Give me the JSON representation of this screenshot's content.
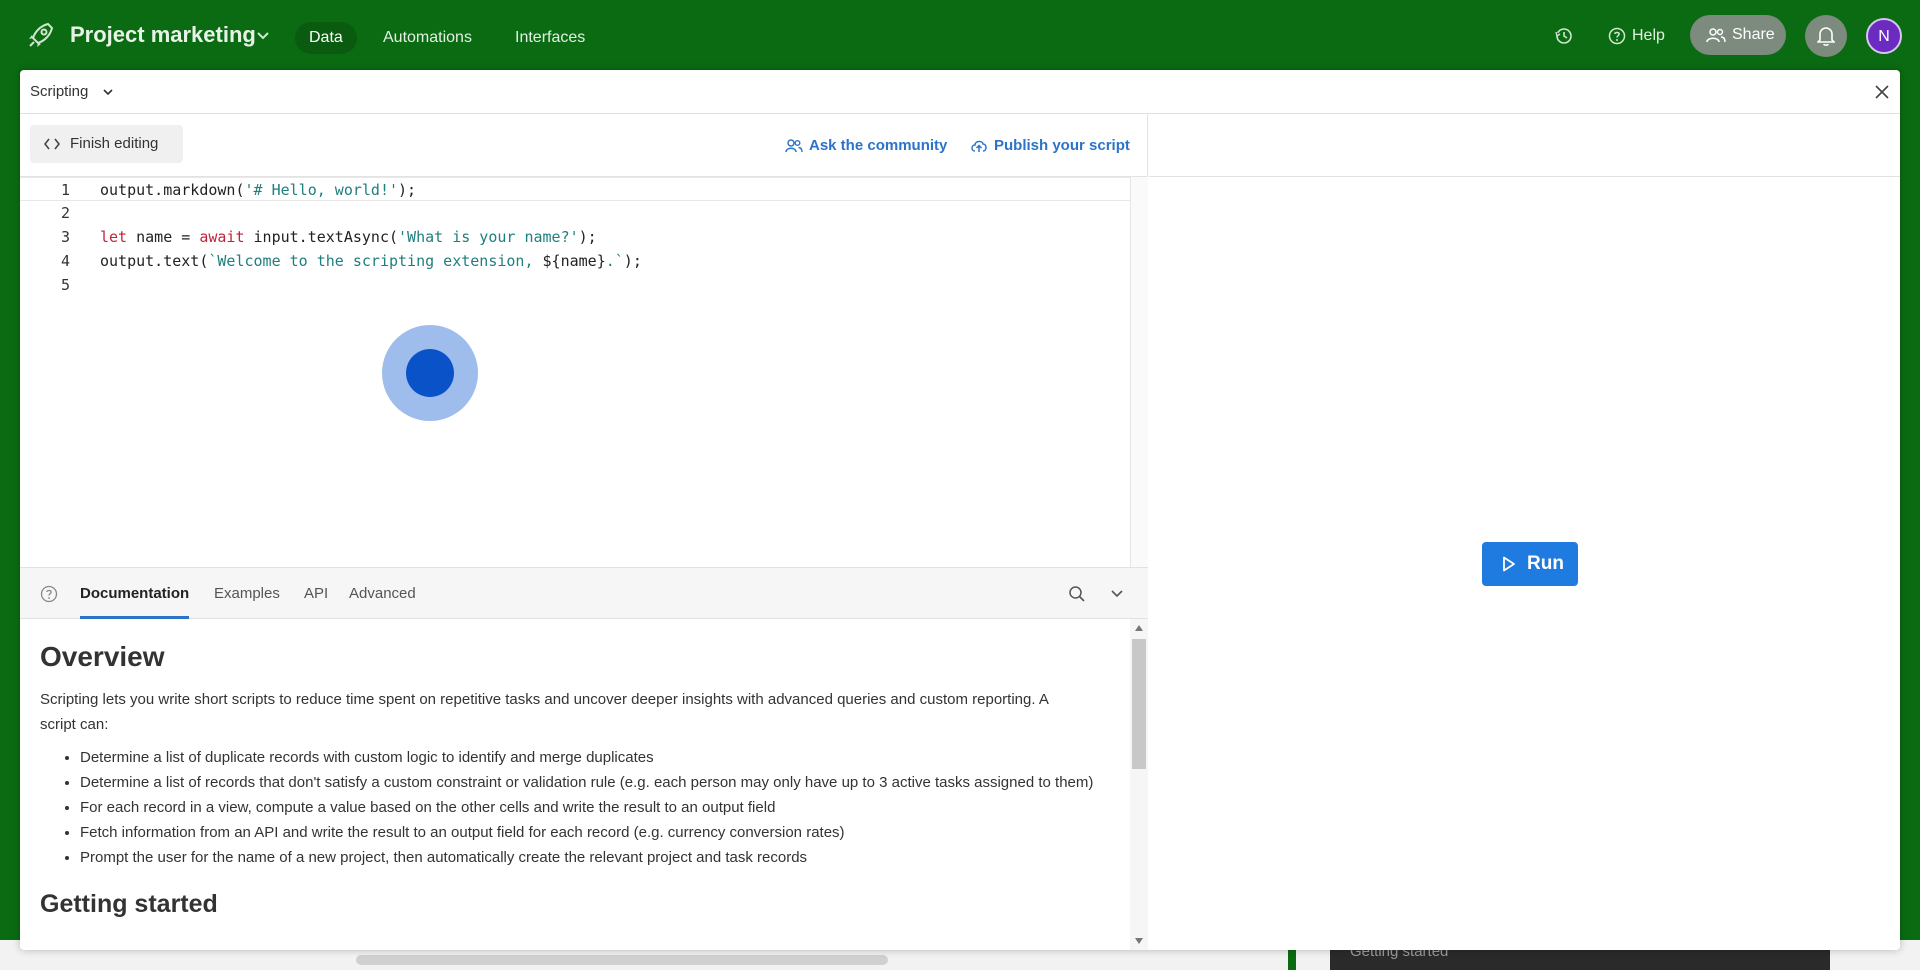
{
  "topbar": {
    "project_title": "Project marketing",
    "tabs": [
      {
        "label": "Data",
        "active": true
      },
      {
        "label": "Automations",
        "active": false
      },
      {
        "label": "Interfaces",
        "active": false
      }
    ],
    "help_label": "Help",
    "share_label": "Share",
    "avatar_initial": "N",
    "colors": {
      "bar": "#0b6b12",
      "avatar": "#6c2bc0"
    }
  },
  "modal": {
    "title": "Scripting",
    "toolbar": {
      "finish_label": "Finish editing",
      "community_label": "Ask the community",
      "publish_label": "Publish your script"
    },
    "editor": {
      "lines": [
        {
          "no": "1",
          "code": "output.markdown('# Hello, world!');"
        },
        {
          "no": "2",
          "code": ""
        },
        {
          "no": "3",
          "code": "let name = await input.textAsync('What is your name?');"
        },
        {
          "no": "4",
          "code": "output.text(`Welcome to the scripting extension, ${name}.`);"
        },
        {
          "no": "5",
          "code": ""
        }
      ]
    },
    "docs": {
      "tabs": [
        "Documentation",
        "Examples",
        "API",
        "Advanced"
      ],
      "active_tab": "Documentation",
      "heading": "Overview",
      "intro": "Scripting lets you write short scripts to reduce time spent on repetitive tasks and uncover deeper insights with advanced queries and custom reporting. A script can:",
      "bullets": [
        "Determine a list of duplicate records with custom logic to identify and merge duplicates",
        "Determine a list of records that don't satisfy a custom constraint or validation rule (e.g. each person may only have up to 3 active tasks assigned to them)",
        "For each record in a view, compute a value based on the other cells and write the result to an output field",
        "Fetch information from an API and write the result to an output field for each record (e.g. currency conversion rates)",
        "Prompt the user for the name of a new project, then automatically create the relevant project and task records"
      ],
      "subheading": "Getting started"
    },
    "run_label": "Run",
    "accent": "#2b74c9"
  },
  "background": {
    "toast_label": "Getting started"
  }
}
